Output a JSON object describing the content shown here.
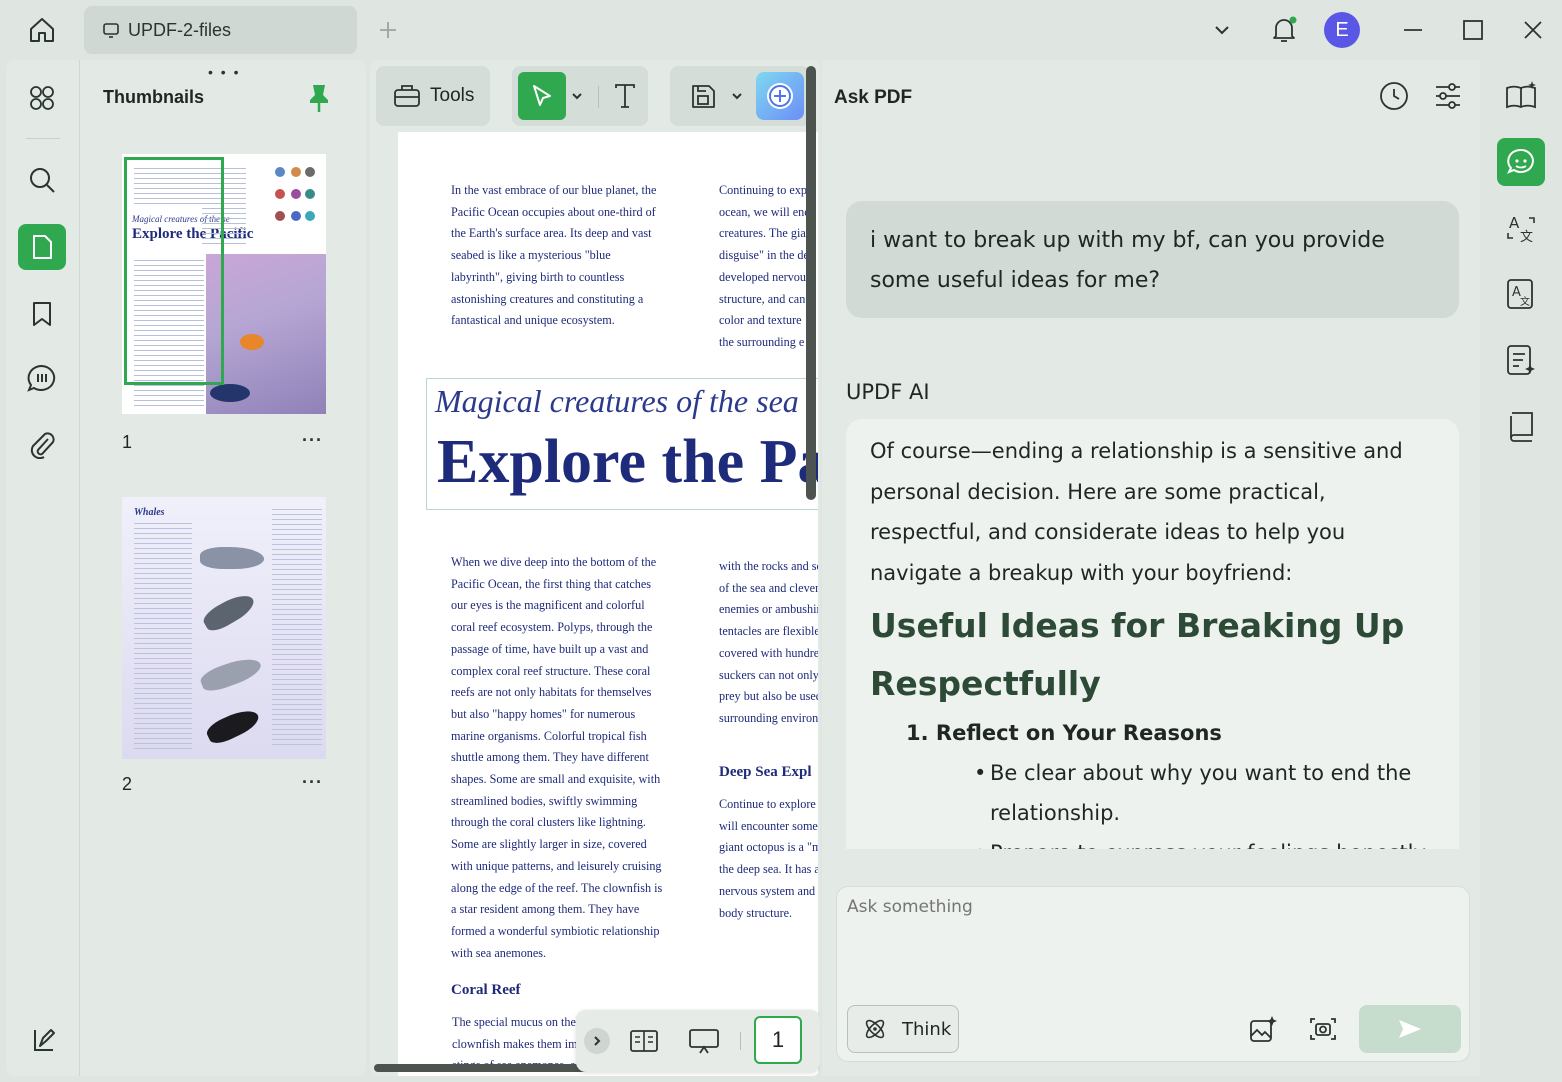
{
  "titlebar": {
    "tab_label": "UPDF-2-files",
    "avatar_letter": "E",
    "accent": "#2fa84f"
  },
  "thumbnails": {
    "title": "Thumbnails",
    "pages": [
      {
        "number": "1",
        "heading_small": "Magical creatures of the se",
        "heading_big": "Explore the Pacific"
      },
      {
        "number": "2",
        "heading_small": "Whales"
      }
    ]
  },
  "toolbar": {
    "tools_label": "Tools"
  },
  "document": {
    "col1_top": [
      "In the vast embrace of our blue planet, the",
      "Pacific Ocean occupies about one-third of",
      "the Earth's surface area. Its deep and vast",
      "seabed is like a mysterious \"blue",
      "labyrinth\", giving birth to countless",
      "astonishing creatures and constituting a",
      "fantastical and unique ecosystem."
    ],
    "col2_top": [
      "Continuing to exp",
      "ocean, we will enc",
      "creatures. The gia",
      "disguise\" in the de",
      "developed nervou",
      "structure, and can",
      "color and texture",
      "the surrounding e"
    ],
    "subtitle": "Magical creatures of the sea",
    "title": "Explore the Pacific",
    "col1_body": [
      "When we dive deep into the bottom of the",
      "Pacific Ocean, the first thing that catches",
      "our eyes is the magnificent and colorful",
      "coral reef ecosystem. Polyps, through the",
      "passage of time, have built up a vast and",
      "complex coral reef structure. These coral",
      "reefs are not only habitats for themselves",
      "but also \"happy homes\" for numerous",
      "marine organisms. Colorful tropical fish",
      "shuttle among them. They have different",
      "shapes. Some are small and exquisite, with",
      "streamlined bodies, swiftly swimming",
      "through the coral clusters like lightning.",
      "Some are slightly larger in size, covered",
      "with unique patterns, and leisurely cruising",
      "along the edge of the reef. The clownfish is",
      "a star resident among them. They have",
      "formed a wonderful symbiotic relationship",
      "with sea anemones."
    ],
    "col2_body": [
      "with the rocks and se",
      "of the sea and clever",
      "enemies or ambushir",
      "tentacles are flexible",
      "covered with hundre",
      "suckers can not only",
      "prey but also be used",
      "surrounding environ"
    ],
    "deep_sea_heading": "Deep Sea Expl",
    "col2_body2": [
      "Continue to explore t",
      "will encounter some",
      "giant octopus is a \"m",
      "the deep sea. It has a",
      "nervous system and t",
      "body structure."
    ],
    "coral_heading": "Coral Reef",
    "col1_tail": [
      "The special mucus on the",
      "clownfish makes them im",
      "stings of sea anemones, a"
    ],
    "page_number": "1"
  },
  "ask": {
    "title": "Ask PDF",
    "user_message": "i want to break up with my bf, can you provide some useful ideas for me?",
    "ai_label": "UPDF AI",
    "ai_intro": "Of course—ending a relationship is a sensitive and personal decision. Here are some practical, respectful, and considerate ideas to help you navigate a breakup with your boyfriend:",
    "ai_heading": "Useful Ideas for Breaking Up Respectfully",
    "ai_item1": "1. Reflect on Your Reasons",
    "ai_bullet1": "Be clear about why you want to end the relationship.",
    "ai_bullet2": "Prepare to express your feelings honestly",
    "input_placeholder": "Ask something",
    "think_label": "Think"
  }
}
